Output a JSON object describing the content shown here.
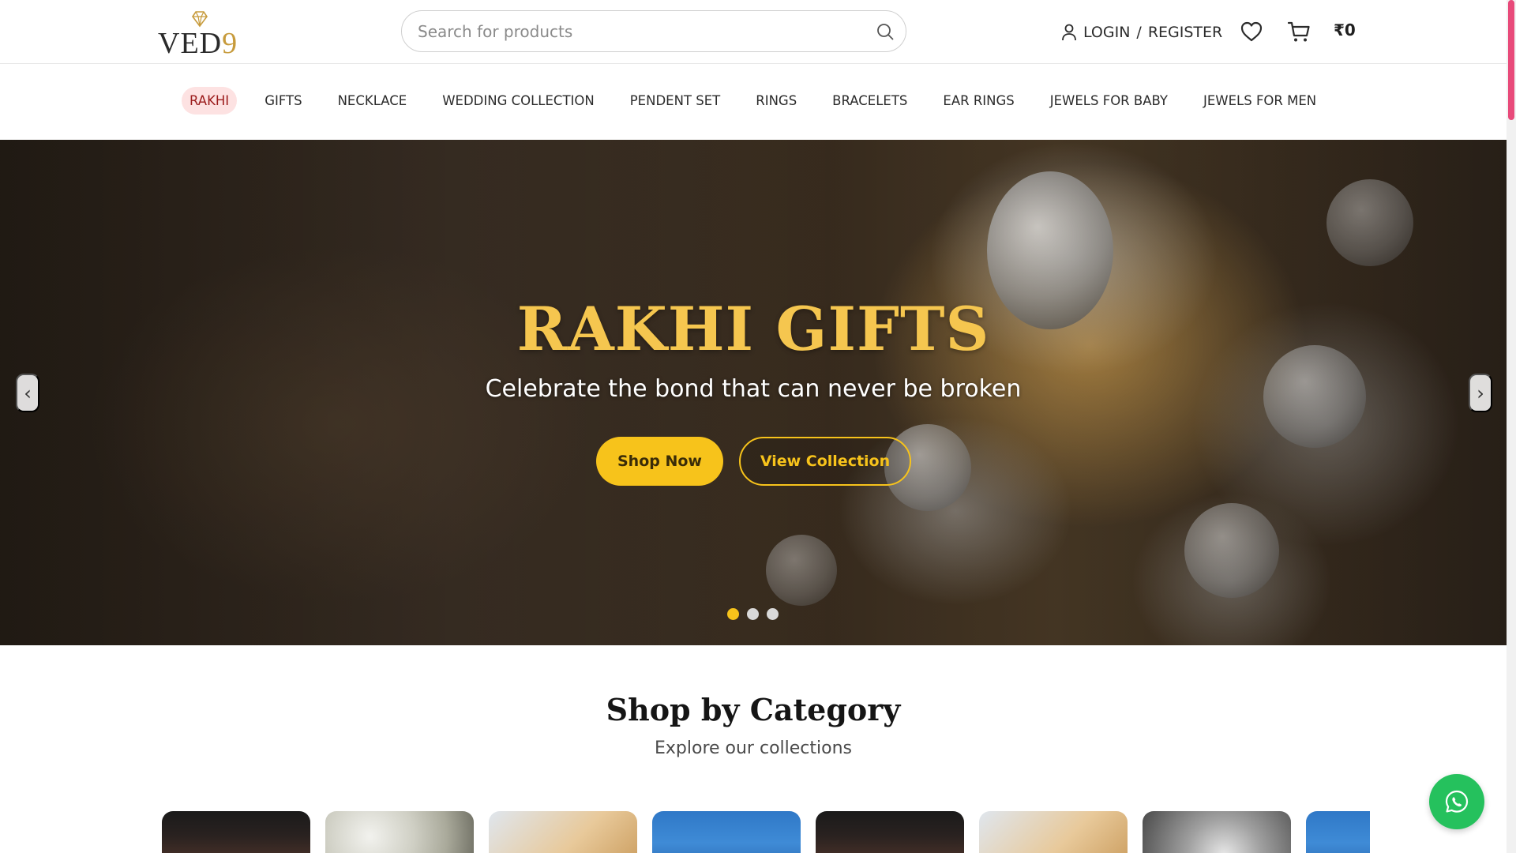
{
  "header": {
    "logo_text": "VED",
    "logo_nine": "9",
    "search_placeholder": "Search for products",
    "login_label": "LOGIN",
    "login_separator": "/",
    "register_label": "REGISTER",
    "cart_total": "₹0",
    "icons": [
      "diamond-icon",
      "search-icon",
      "user-icon",
      "heart-icon",
      "cart-icon"
    ]
  },
  "nav": {
    "items": [
      {
        "label": "RAKHI",
        "active": true
      },
      {
        "label": "GIFTS"
      },
      {
        "label": "NECKLACE"
      },
      {
        "label": "WEDDING COLLECTION"
      },
      {
        "label": "PENDENT SET"
      },
      {
        "label": "RINGS"
      },
      {
        "label": "BRACELETS"
      },
      {
        "label": "EAR RINGS"
      },
      {
        "label": "JEWELS FOR BABY"
      },
      {
        "label": "JEWELS FOR MEN"
      }
    ]
  },
  "hero": {
    "title": "RAKHI GIFTS",
    "subtitle": "Celebrate the bond that can never be broken",
    "primary_cta": "Shop Now",
    "secondary_cta": "View Collection",
    "prev_arrow": "‹",
    "next_arrow": "›",
    "slide_count": 3,
    "active_slide": 1
  },
  "category": {
    "title": "Shop by Category",
    "subtitle": "Explore our collections"
  },
  "colors": {
    "accent_gold": "#f7c31b",
    "nav_active_bg": "#fde2e2",
    "nav_active_text": "#9b1c1c",
    "whatsapp_green": "#25c15d",
    "scroll_thumb": "#e84a7a"
  }
}
